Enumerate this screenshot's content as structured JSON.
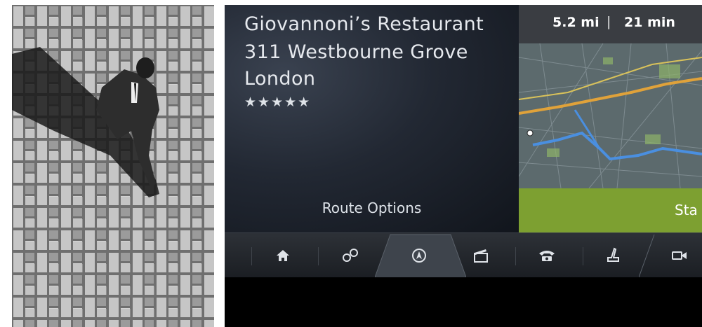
{
  "destination": {
    "name": "Giovannoni’s Restaurant",
    "street": "311 Westbourne Grove",
    "city": "London",
    "rating_stars": "★★★★★",
    "rating": 5
  },
  "route_info": {
    "distance": "5.2 mi",
    "separator": "|",
    "duration": "21 min"
  },
  "buttons": {
    "route_options": "Route Options",
    "start": "Sta"
  },
  "nav_bar": {
    "items": [
      {
        "name": "home",
        "icon": "home-icon"
      },
      {
        "name": "connections",
        "icon": "link-icon"
      },
      {
        "name": "navigation",
        "icon": "navigation-icon",
        "active": true
      },
      {
        "name": "media",
        "icon": "clapperboard-icon"
      },
      {
        "name": "phone",
        "icon": "phone-icon"
      },
      {
        "name": "seat",
        "icon": "seat-icon"
      },
      {
        "name": "camera",
        "icon": "video-camera-icon"
      }
    ]
  },
  "colors": {
    "start_button": "#7da031",
    "info_bar": "#3a3d42",
    "route_line": "#4a8fe0",
    "screen_background": "#05070b"
  }
}
